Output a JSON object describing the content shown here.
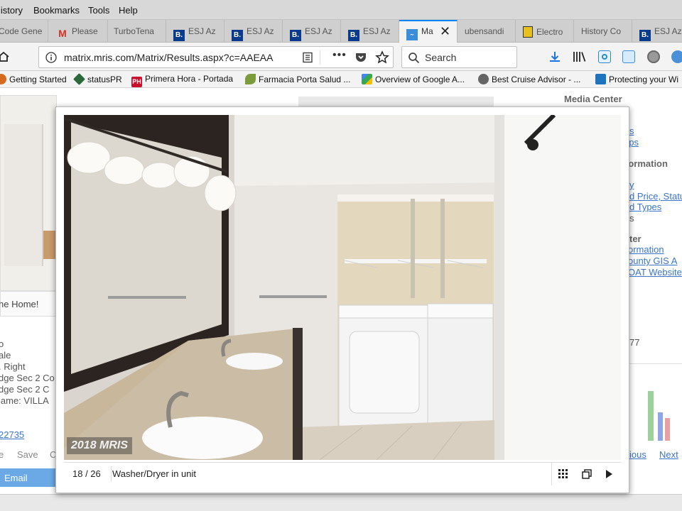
{
  "menu": [
    "listory",
    "Bookmarks",
    "Tools",
    "Help"
  ],
  "tabs": [
    {
      "label": "Code Gene",
      "icon": "none"
    },
    {
      "label": "Please",
      "icon": "gmail-icon"
    },
    {
      "label": "TurboTena",
      "icon": "none"
    },
    {
      "label": "ESJ Az",
      "icon": "booking-icon"
    },
    {
      "label": "ESJ Az",
      "icon": "booking-icon"
    },
    {
      "label": "ESJ Az",
      "icon": "booking-icon"
    },
    {
      "label": "ESJ Az",
      "icon": "booking-icon"
    },
    {
      "label": "Ma",
      "icon": "matrix-icon",
      "active": true
    },
    {
      "label": "ubensandi",
      "icon": "none"
    },
    {
      "label": "Electro",
      "icon": "note-icon"
    },
    {
      "label": "History Co",
      "icon": "none"
    },
    {
      "label": "ESJ Az",
      "icon": "booking-icon"
    }
  ],
  "url": "matrix.mris.com/Matrix/Results.aspx?c=AAEAA",
  "search_placeholder": "Search",
  "bookmarks": [
    {
      "label": "Getting Started",
      "color": "#d56b1f"
    },
    {
      "label": "statusPR",
      "color": "#2a6a3a"
    },
    {
      "label": "Primera Hora - Portada",
      "color": "#c8102e"
    },
    {
      "label": "Farmacia Porta Salud ...",
      "color": "#7a9c3a"
    },
    {
      "label": "Overview of Google A...",
      "color": "#2f8f3f"
    },
    {
      "label": "Best Cruise Advisor - ...",
      "color": "#555555"
    },
    {
      "label": "Protecting your Wi",
      "color": "#1e73be"
    }
  ],
  "page": {
    "media_center": "Media Center",
    "right_links": [
      "s",
      "aps",
      "y",
      "d Price, Status",
      "d Types",
      "s",
      "ormation",
      "ounty GIS A",
      "OAT Website"
    ],
    "right_heads": [
      "formation",
      "ter"
    ],
    "num": "77",
    "prev": "ious",
    "next": "Next",
    "home_text": "he Home!",
    "left_lines": [
      "o",
      "ale",
      ". Right",
      "dge Sec 2 Co",
      "dge Sec 2 C",
      "lame:  VILLA"
    ],
    "left_link": "22735",
    "save_row": [
      "e",
      "Save",
      "C"
    ],
    "email": "Email"
  },
  "modal": {
    "counter": "18 / 26",
    "caption": "Washer/Dryer in unit",
    "watermark": "2018 MRIS"
  }
}
